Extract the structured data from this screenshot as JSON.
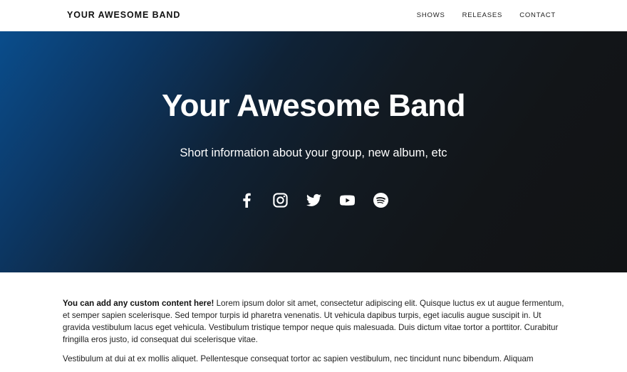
{
  "navbar": {
    "brand": "YOUR AWESOME BAND",
    "links": [
      "SHOWS",
      "RELEASES",
      "CONTACT"
    ]
  },
  "hero": {
    "title": "Your Awesome Band",
    "subtitle": "Short information about your group, new album, etc",
    "gradient_colors": [
      "#0a4d8c",
      "#121518"
    ],
    "socials": [
      "facebook-icon",
      "instagram-icon",
      "twitter-icon",
      "youtube-icon",
      "spotify-icon"
    ]
  },
  "content": {
    "lead": "You can add any custom content here!",
    "p1_rest": " Lorem ipsum dolor sit amet, consectetur adipiscing elit. Quisque luctus ex ut augue fermentum, et semper sapien scelerisque. Sed tempor turpis id pharetra venenatis. Ut vehicula dapibus turpis, eget iaculis augue suscipit in. Ut gravida vestibulum lacus eget vehicula. Vestibulum tristique tempor neque quis malesuada. Duis dictum vitae tortor a porttitor. Curabitur fringilla eros justo, id consequat dui scelerisque vitae.",
    "p2": "Vestibulum at dui at ex mollis aliquet. Pellentesque consequat tortor ac sapien vestibulum, nec tincidunt nunc bibendum. Aliquam"
  }
}
